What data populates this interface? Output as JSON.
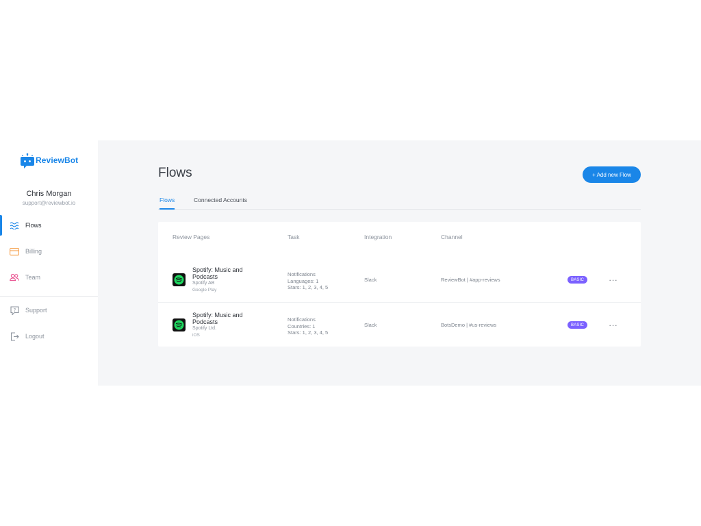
{
  "brand": {
    "name": "ReviewBot",
    "accent": "#1a86e8"
  },
  "user": {
    "name": "Chris Morgan",
    "email": "support@reviewbot.io"
  },
  "nav": [
    {
      "label": "Flows",
      "icon": "flows-icon",
      "active": true
    },
    {
      "label": "Billing",
      "icon": "card-icon"
    },
    {
      "label": "Team",
      "icon": "team-icon"
    },
    {
      "label": "Support",
      "icon": "help-icon"
    },
    {
      "label": "Logout",
      "icon": "logout-icon"
    }
  ],
  "page": {
    "title": "Flows",
    "add_button": "+ Add new Flow"
  },
  "tabs": [
    {
      "label": "Flows",
      "active": true
    },
    {
      "label": "Connected Accounts"
    }
  ],
  "table": {
    "headers": [
      "Review Pages",
      "Task",
      "Integration",
      "Channel"
    ],
    "rows": [
      {
        "app_name": "Spotify: Music and Podcasts",
        "developer": "Spotify AB",
        "store": "Google Play",
        "task": [
          "Notifications",
          "Languages: 1",
          "Stars: 1, 2, 3, 4, 5"
        ],
        "integration": "Slack",
        "channel": "ReviewBot | #app-reviews",
        "plan": "BASIC",
        "more": "..."
      },
      {
        "app_name": "Spotify: Music and Podcasts",
        "developer": "Spotify Ltd.",
        "store": "iOS",
        "task": [
          "Notifications",
          "Countries: 1",
          "Stars: 1, 2, 3, 4, 5"
        ],
        "integration": "Slack",
        "channel": "BotsDemo | #us-reviews",
        "plan": "BASIC",
        "more": "..."
      }
    ]
  },
  "colors": {
    "primary": "#1a86e8",
    "badge": "#7b61ff",
    "spotify_green": "#1ed760",
    "billing": "#f5a04b",
    "team": "#e8488a"
  }
}
